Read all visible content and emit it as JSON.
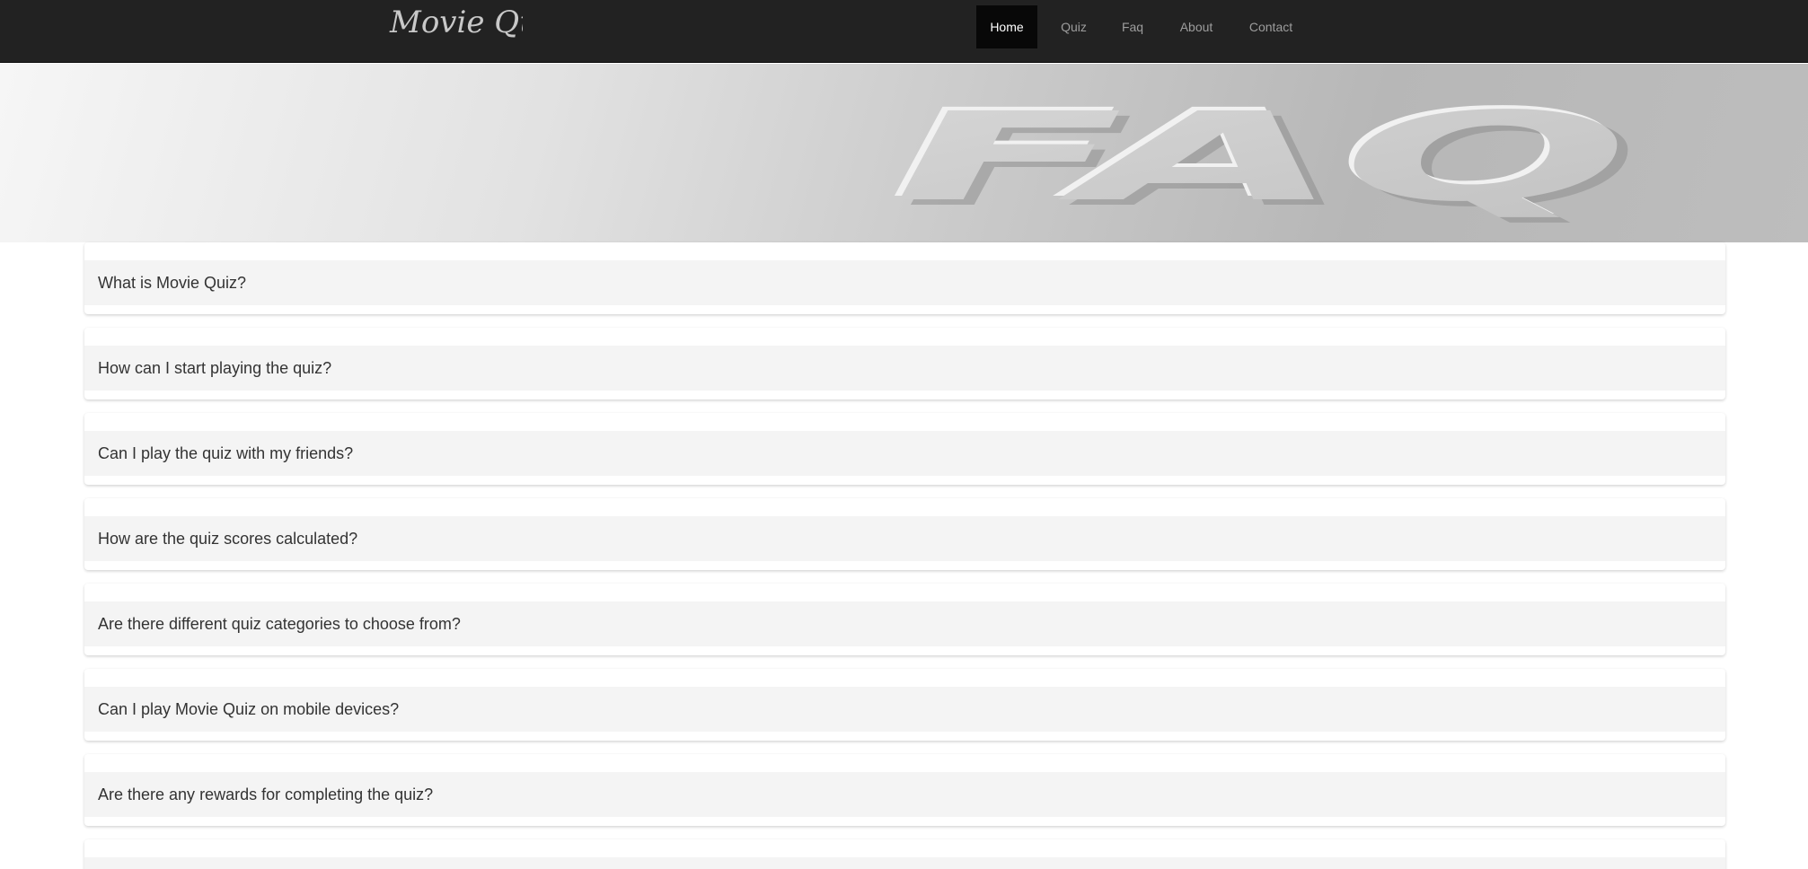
{
  "brand": {
    "logo_text": "Movie Quiz"
  },
  "nav": {
    "items": [
      {
        "label": "Home",
        "active": true
      },
      {
        "label": "Quiz",
        "active": false
      },
      {
        "label": "Faq",
        "active": false
      },
      {
        "label": "About",
        "active": false
      },
      {
        "label": "Contact",
        "active": false
      }
    ]
  },
  "hero": {
    "banner_text": "FAQ"
  },
  "faq": {
    "questions": [
      "What is Movie Quiz?",
      "How can I start playing the quiz?",
      "Can I play the quiz with my friends?",
      "How are the quiz scores calculated?",
      "Are there different quiz categories to choose from?",
      "Can I play Movie Quiz on mobile devices?",
      "Are there any rewards for completing the quiz?",
      ""
    ]
  },
  "colors": {
    "navbar_bg": "#222222",
    "nav_active_bg": "#080808",
    "nav_text": "#9d9d9d",
    "question_bg": "#f4f4f4",
    "question_text": "#333333"
  }
}
